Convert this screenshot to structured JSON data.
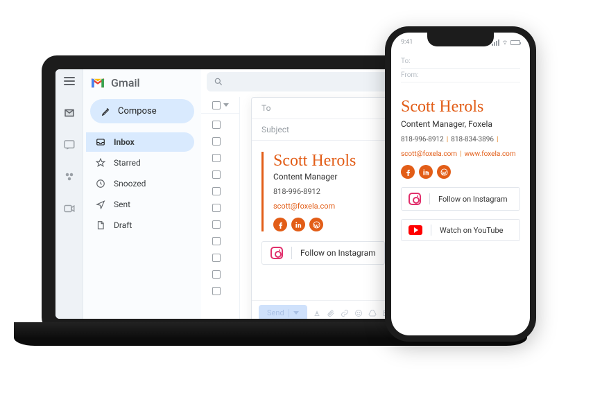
{
  "gmail": {
    "brand": "Gmail",
    "compose_label": "Compose",
    "nav": [
      {
        "label": "Inbox",
        "icon": "inbox"
      },
      {
        "label": "Starred",
        "icon": "star"
      },
      {
        "label": "Snoozed",
        "icon": "clock"
      },
      {
        "label": "Sent",
        "icon": "send"
      },
      {
        "label": "Draft",
        "icon": "draft"
      }
    ]
  },
  "compose": {
    "to_label": "To",
    "subject_label": "Subject",
    "send_label": "Send",
    "signature": {
      "name": "Scott Herols",
      "title": "Content Manager",
      "phone": "818-996-8912",
      "email": "scott@foxela.com"
    },
    "cta_instagram": "Follow on Instagram"
  },
  "phone": {
    "time": "9:41",
    "to_label": "To:",
    "from_label": "From:",
    "signature": {
      "name": "Scott Herols",
      "title": "Content Manager, Foxela",
      "phone1": "818-996-8912",
      "phone2": "818-834-3896",
      "email": "scott@foxela.com",
      "website": "www.foxela.com"
    },
    "cta_instagram": "Follow on Instagram",
    "cta_youtube": "Watch on YouTube"
  }
}
